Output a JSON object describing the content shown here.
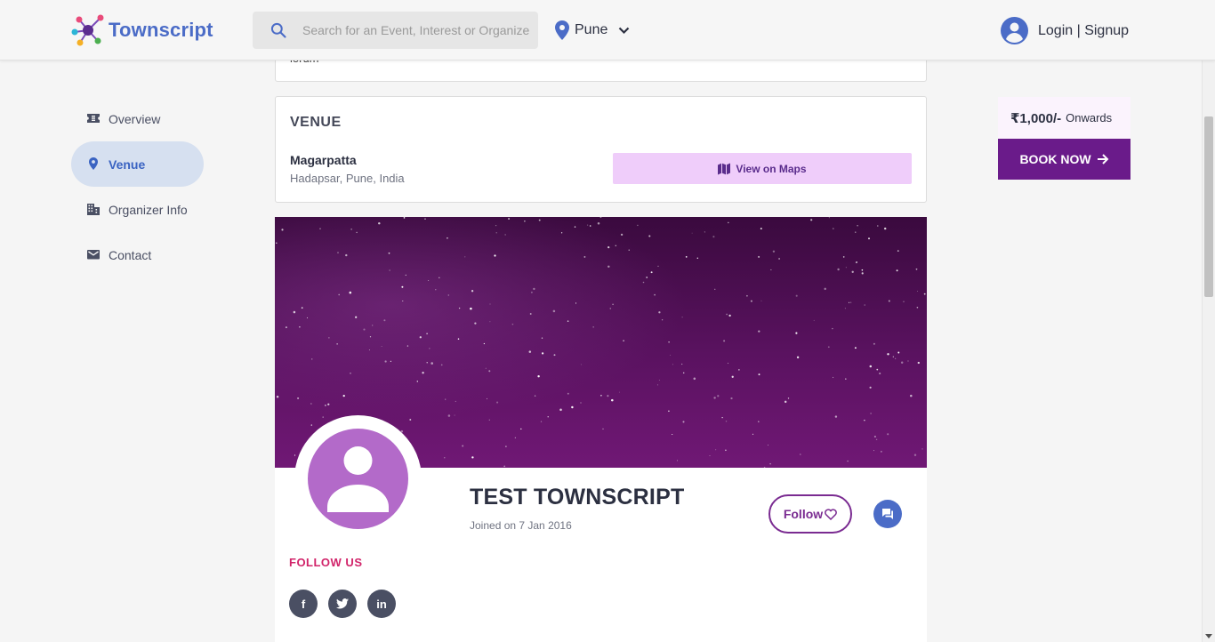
{
  "header": {
    "logo_text": "Townscript",
    "search_placeholder": "Search for an Event, Interest or Organizer",
    "city": "Pune",
    "login_label": "Login | Signup"
  },
  "sidebar": {
    "items": [
      {
        "label": "Overview",
        "icon": "ticket-icon",
        "active": false
      },
      {
        "label": "Venue",
        "icon": "map-pin-icon",
        "active": true
      },
      {
        "label": "Organizer Info",
        "icon": "building-icon",
        "active": false
      },
      {
        "label": "Contact",
        "icon": "mail-icon",
        "active": false
      }
    ]
  },
  "previous_card": {
    "text": "lorum"
  },
  "venue": {
    "title": "VENUE",
    "name": "Magarpatta",
    "address": "Hadapsar, Pune, India",
    "maps_label": "View on Maps"
  },
  "organizer": {
    "name": "TEST TOWNSCRIPT",
    "joined": "Joined on 7 Jan 2016",
    "follow_label": "Follow",
    "follow_us_label": "FOLLOW US",
    "social": [
      {
        "icon": "facebook-icon",
        "glyph": "f"
      },
      {
        "icon": "twitter-icon",
        "glyph": ""
      },
      {
        "icon": "linkedin-icon",
        "glyph": "in"
      }
    ]
  },
  "booking": {
    "price": "₹1,000/-",
    "price_suffix": "Onwards",
    "book_label": "BOOK NOW"
  },
  "colors": {
    "accent_blue": "#4b6cc7",
    "brand_purple": "#6a1b8a",
    "follow_us_pink": "#d1246a",
    "maps_button_bg": "#efcdfa"
  }
}
